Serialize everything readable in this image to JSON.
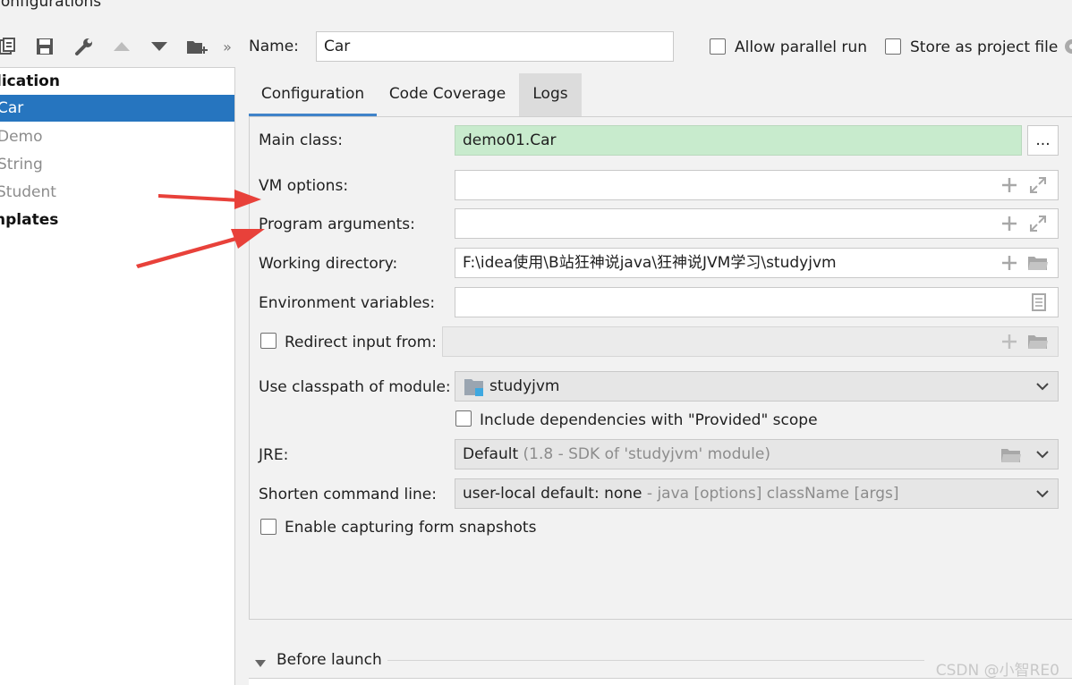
{
  "window": {
    "title": "ug Configurations"
  },
  "tree": {
    "items": [
      {
        "label": "lication",
        "style": "bold"
      },
      {
        "label": "Car",
        "style": "selected"
      },
      {
        "label": "Demo",
        "style": "dim"
      },
      {
        "label": "String",
        "style": "dim"
      },
      {
        "label": "Student",
        "style": "dim"
      },
      {
        "label": "nplates",
        "style": "bold"
      }
    ]
  },
  "toolbar": {
    "icons": [
      "copy-icon",
      "save-icon",
      "wrench-icon",
      "move-up-icon",
      "move-down-icon",
      "new-folder-icon",
      "more-chevron-icon"
    ],
    "more_label": "»"
  },
  "header": {
    "name_label": "Name:",
    "name_value": "Car",
    "allow_parallel_label": "Allow parallel run",
    "store_as_project_label": "Store as project file"
  },
  "tabs": [
    {
      "label": "Configuration",
      "state": "active"
    },
    {
      "label": "Code Coverage",
      "state": "normal"
    },
    {
      "label": "Logs",
      "state": "hover"
    }
  ],
  "form": {
    "main_class_label": "Main class:",
    "main_class_value": "demo01.Car",
    "browse_label": "...",
    "vm_options_label": "VM options:",
    "vm_options_value": "",
    "program_args_label": "Program arguments:",
    "program_args_value": "",
    "working_dir_label": "Working directory:",
    "working_dir_value": "F:\\idea使用\\B站狂神说java\\狂神说JVM学习\\studyjvm",
    "env_vars_label": "Environment variables:",
    "env_vars_value": "",
    "redirect_label": "Redirect input from:",
    "redirect_value": "",
    "classpath_label": "Use classpath of module:",
    "classpath_value": "studyjvm",
    "include_deps_label": "Include dependencies with \"Provided\" scope",
    "jre_label": "JRE:",
    "jre_value": "Default",
    "jre_hint": "(1.8 - SDK of 'studyjvm' module)",
    "shorten_label": "Shorten command line:",
    "shorten_value": "user-local default: none",
    "shorten_hint": "- java [options] className [args]",
    "snapshots_label": "Enable capturing form snapshots"
  },
  "before_launch": {
    "label": "Before launch"
  },
  "watermark": "CSDN @小智RE0",
  "colors": {
    "selection": "#2675bf",
    "main_class_bg": "#c8ebcd",
    "arrow_red": "#e8413a",
    "tab_underline": "#4083c9"
  }
}
